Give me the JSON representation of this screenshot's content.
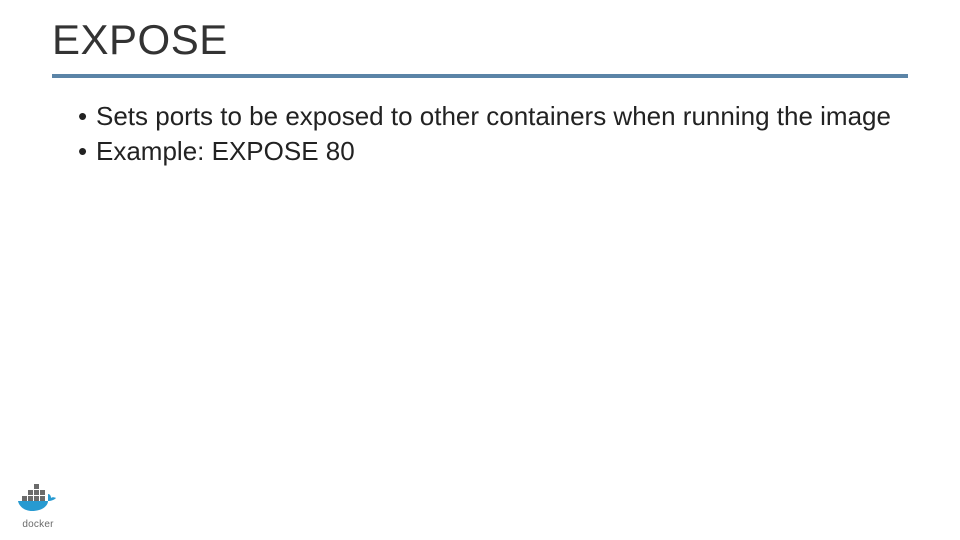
{
  "title": "EXPOSE",
  "bullets": [
    "Sets ports to be exposed to other containers when running the image",
    "Example: EXPOSE 80"
  ],
  "logo": {
    "label": "docker",
    "accent": "#279ad1",
    "gray": "#6b6b6b"
  }
}
